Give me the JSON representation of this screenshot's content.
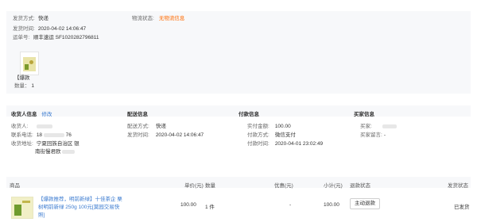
{
  "shipment": {
    "method_label": "发货方式:",
    "method_value": "快递",
    "status_label": "物流状态:",
    "status_value": "无物流信息",
    "time_label": "发货时间:",
    "time_value": "2020-04-02 14:06:47",
    "tracking_label": "运单号:",
    "carrier": "顺丰速运",
    "tracking_no": "SF1020282796811",
    "item_note": "【爆款",
    "qty_label": "数量：",
    "qty_value": "1"
  },
  "consignee": {
    "title": "收货人信息",
    "edit_link": "修改",
    "name_label": "收货人:",
    "phone_label": "联系电话:",
    "phone_value": "18",
    "phone_tail": "76",
    "address_label": "收货地址:",
    "address_line1": "宁夏回族自治区 银",
    "address_line2": "南街慢君欧"
  },
  "delivery": {
    "title": "配送信息",
    "method_label": "配送方式:",
    "method_value": "快递",
    "time_label": "发货时间:",
    "time_value": "2020-04-02 14:06:47"
  },
  "payment": {
    "title": "付款信息",
    "paid_label": "实付金额:",
    "paid_value": "100.00",
    "way_label": "付款方式:",
    "way_value": "微信支付",
    "time_label": "付款时间:",
    "time_value": "2020-04-01 23:02:49"
  },
  "buyer": {
    "title": "买家信息",
    "buyer_label": "买家:",
    "note_label": "买家留言:",
    "note_value": "-"
  },
  "table": {
    "headers": [
      "商品",
      "单价(元)",
      "数量",
      "优惠(元)",
      "小计(元)",
      "退款状态",
      "发货状态"
    ],
    "rows": [
      {
        "name": "【爆款推荐，明前新绿】十佳茶企 栗树明前新绿 250g 100元[莫园交易快照]",
        "unit_price": "100.00",
        "qty": "1 件",
        "discount": "-",
        "subtotal": "100.00",
        "refund_button": "主动退款",
        "ship_status": "已发货"
      }
    ]
  }
}
